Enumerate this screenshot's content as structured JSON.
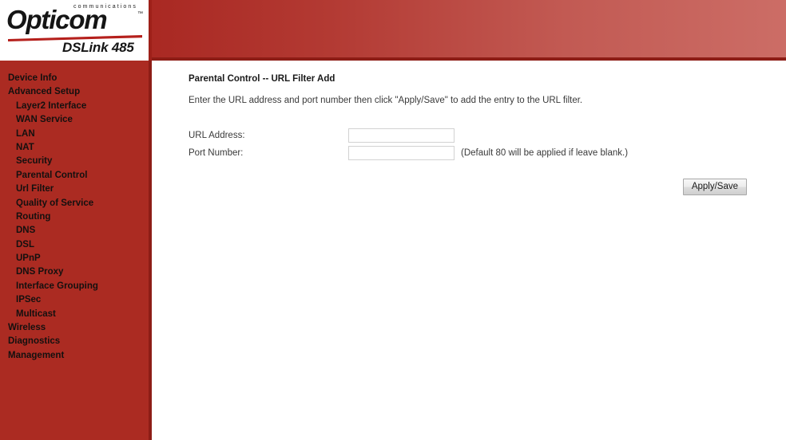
{
  "brand": {
    "tagline": "communications",
    "name": "Opticom",
    "trademark": "™",
    "model": "DSLink 485"
  },
  "sidebar": {
    "items": [
      {
        "label": "Device Info",
        "level": 0
      },
      {
        "label": "Advanced Setup",
        "level": 0
      },
      {
        "label": "Layer2 Interface",
        "level": 1
      },
      {
        "label": "WAN Service",
        "level": 1
      },
      {
        "label": "LAN",
        "level": 1
      },
      {
        "label": "NAT",
        "level": 1
      },
      {
        "label": "Security",
        "level": 1
      },
      {
        "label": "Parental Control",
        "level": 1
      },
      {
        "label": "Url Filter",
        "level": 1
      },
      {
        "label": "Quality of Service",
        "level": 1
      },
      {
        "label": "Routing",
        "level": 1
      },
      {
        "label": "DNS",
        "level": 1
      },
      {
        "label": "DSL",
        "level": 1
      },
      {
        "label": "UPnP",
        "level": 1
      },
      {
        "label": "DNS Proxy",
        "level": 1
      },
      {
        "label": "Interface Grouping",
        "level": 1
      },
      {
        "label": "IPSec",
        "level": 1
      },
      {
        "label": "Multicast",
        "level": 1
      },
      {
        "label": "Wireless",
        "level": 0
      },
      {
        "label": "Diagnostics",
        "level": 0
      },
      {
        "label": "Management",
        "level": 0
      }
    ]
  },
  "main": {
    "title": "Parental Control -- URL Filter Add",
    "description": "Enter the URL address and port number then click \"Apply/Save\" to add the entry to the URL filter.",
    "fields": [
      {
        "label": "URL Address:",
        "value": "",
        "placeholder": "",
        "hint": ""
      },
      {
        "label": "Port Number:",
        "value": "",
        "placeholder": "",
        "hint": "(Default 80 will be applied if leave blank.)"
      }
    ],
    "apply_button_label": "Apply/Save"
  },
  "colors": {
    "brand_red": "#ab2b22",
    "header_dark": "#9e2019",
    "header_light": "#cc6d66",
    "sidebar_text": "#14100f"
  }
}
